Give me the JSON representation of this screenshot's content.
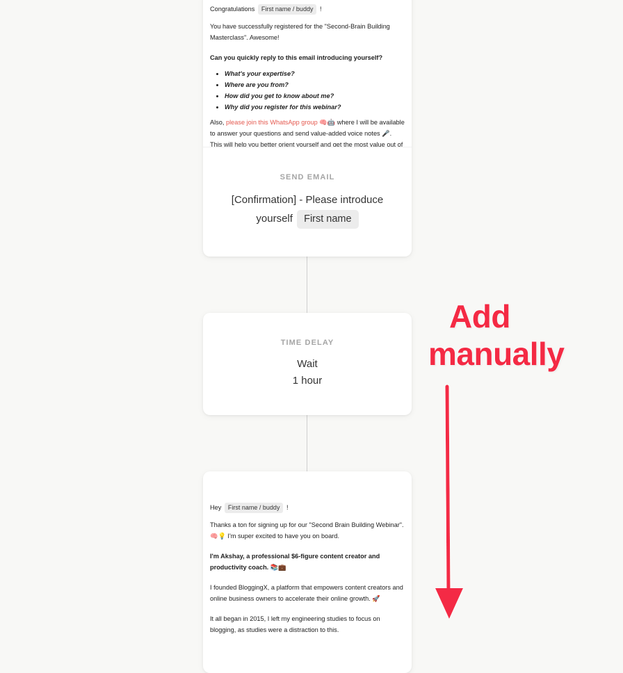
{
  "email1": {
    "preview": {
      "greeting_prefix": "Congratulations",
      "greeting_chip": "First name / buddy",
      "greeting_suffix": "!",
      "para1": "You have successfully registered for the \"Second-Brain Building Masterclass\". Awesome!",
      "question": "Can you quickly reply to this email introducing yourself?",
      "bullets": [
        "What's your expertise?",
        "Where are you from?",
        "How did you get to know about me?",
        "Why did you register for this webinar?"
      ],
      "para2_prefix": "Also,",
      "para2_link": "please join this WhatsApp group",
      "para2_emoji": "🧠🤖",
      "para2_suffix": "where I will be available to answer your questions and send value-added voice notes 🎤. This will help you better orient yourself and get the most value out of the webinar."
    },
    "label": "SEND EMAIL",
    "subject_line1": "[Confirmation] - Please introduce",
    "subject_line2": "yourself",
    "subject_chip": "First name"
  },
  "delay": {
    "label": "TIME DELAY",
    "line1": "Wait",
    "line2": "1 hour"
  },
  "email2": {
    "preview": {
      "greeting_prefix": "Hey",
      "greeting_chip": "First name / buddy",
      "greeting_suffix": "!",
      "para1": "Thanks a ton for signing up for our \"Second Brain Building Webinar\". 🧠💡 I'm super excited to have you on board.",
      "para2": "I'm Akshay, a professional $6-figure content creator and productivity coach. 📚💼",
      "para3": "I founded BloggingX, a platform that empowers content creators and online business owners to accelerate their online growth. 🚀",
      "para4": "It all began in 2015, I left my engineering studies to focus on blogging, as studies were a distraction to this."
    }
  },
  "annotation": {
    "line1": "Add",
    "line2": "manually",
    "color": "#f42a44"
  }
}
